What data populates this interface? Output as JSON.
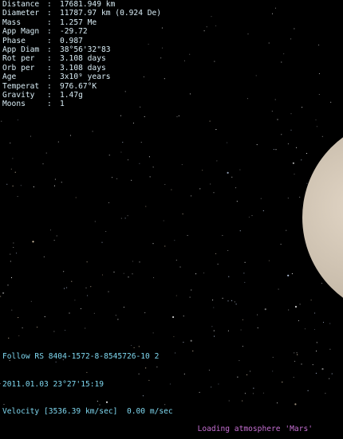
{
  "info": [
    {
      "label": "Distance",
      "value": "17681.949 km"
    },
    {
      "label": "Diameter",
      "value": "11787.97 km (0.924 De)"
    },
    {
      "label": "Mass",
      "value": "1.257 Me"
    },
    {
      "label": "App Magn",
      "value": "-29.72"
    },
    {
      "label": "Phase",
      "value": "0.987"
    },
    {
      "label": "App Diam",
      "value": "38°56'32\"83"
    },
    {
      "label": "Rot per",
      "value": "3.108 days"
    },
    {
      "label": "Orb per",
      "value": "3.108 days"
    },
    {
      "label": "Age",
      "value": "3x10⁹ years"
    },
    {
      "label": "Temperat",
      "value": "976.67°K"
    },
    {
      "label": "Gravity",
      "value": "1.47g"
    },
    {
      "label": "Moons",
      "value": "1"
    }
  ],
  "separator": ":",
  "status": {
    "follow": "Follow RS 8404-1572-8-8545726-10 2",
    "datetime": "2011.01.03 23°27'15:19",
    "velocity": "Velocity [3536.39 km/sec]  0.00 m/sec"
  },
  "loading": "Loading atmosphere 'Mars'",
  "colors": {
    "background": "#000000",
    "info_text": "#d8ecf5",
    "status_text": "#7fd8f0",
    "loading_text": "#c56fd2",
    "planet": "#cbbfae"
  }
}
